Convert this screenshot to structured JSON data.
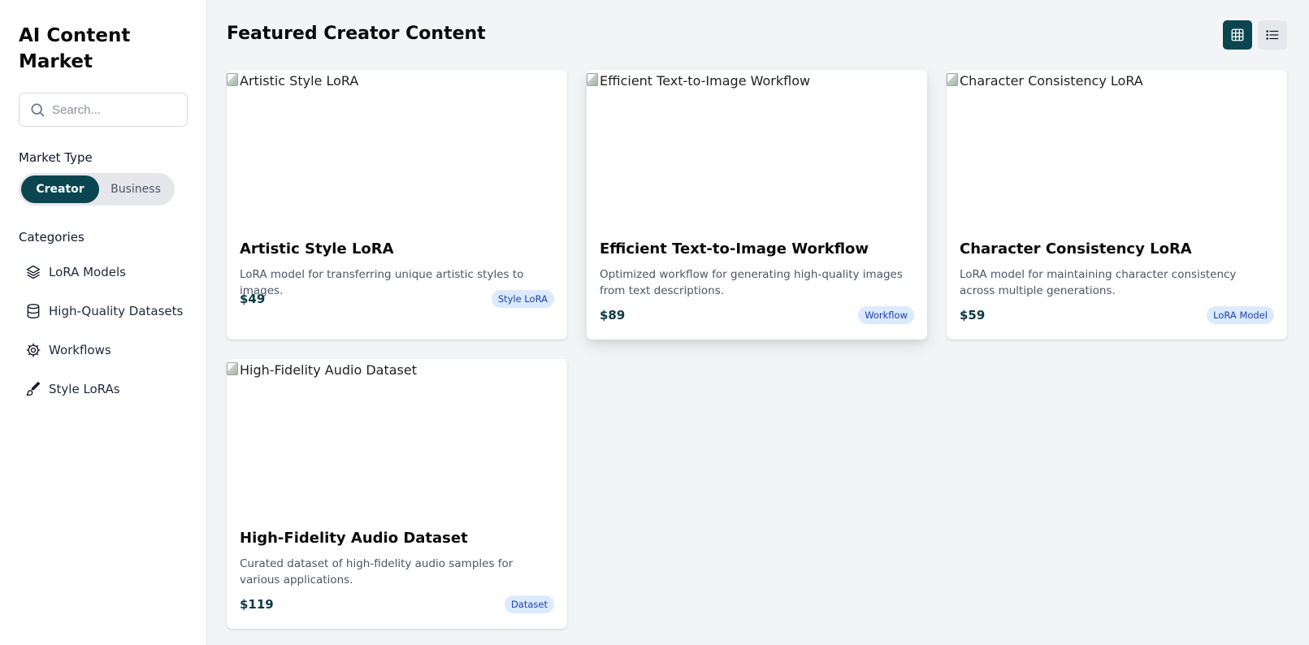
{
  "sidebar": {
    "brand": "AI Content Market",
    "search": {
      "placeholder": "Search..."
    },
    "market_type": {
      "label": "Market Type",
      "options": [
        "Creator",
        "Business"
      ],
      "selected": "Creator"
    },
    "categories": {
      "label": "Categories",
      "items": [
        {
          "label": "LoRA Models",
          "icon": "layers-icon"
        },
        {
          "label": "High-Quality Datasets",
          "icon": "database-icon"
        },
        {
          "label": "Workflows",
          "icon": "gear-icon"
        },
        {
          "label": "Style LoRAs",
          "icon": "brush-icon"
        }
      ]
    }
  },
  "main": {
    "title": "Featured Creator Content",
    "view_toggle": {
      "selected": "grid",
      "options": [
        "grid-icon",
        "list-icon"
      ]
    },
    "cards": [
      {
        "image_alt": "Artistic Style LoRA",
        "title": "Artistic Style LoRA",
        "description": "LoRA model for transferring unique artistic styles to images.",
        "price": "$49",
        "tag": "Style LoRA"
      },
      {
        "image_alt": "Efficient Text-to-Image Workflow",
        "title": "Efficient Text-to-Image Workflow",
        "description": "Optimized workflow for generating high-quality images from text descriptions.",
        "price": "$89",
        "tag": "Workflow"
      },
      {
        "image_alt": "Character Consistency LoRA",
        "title": "Character Consistency LoRA",
        "description": "LoRA model for maintaining character consistency across multiple generations.",
        "price": "$59",
        "tag": "LoRA Model"
      },
      {
        "image_alt": "High-Fidelity Audio Dataset",
        "title": "High-Fidelity Audio Dataset",
        "description": "Curated dataset of high-fidelity audio samples for various applications.",
        "price": "$119",
        "tag": "Dataset"
      }
    ]
  },
  "colors": {
    "accent": "#0b4650",
    "background": "#f3f4f6",
    "badge_bg": "#dbeafe",
    "badge_text": "#1e40af"
  }
}
